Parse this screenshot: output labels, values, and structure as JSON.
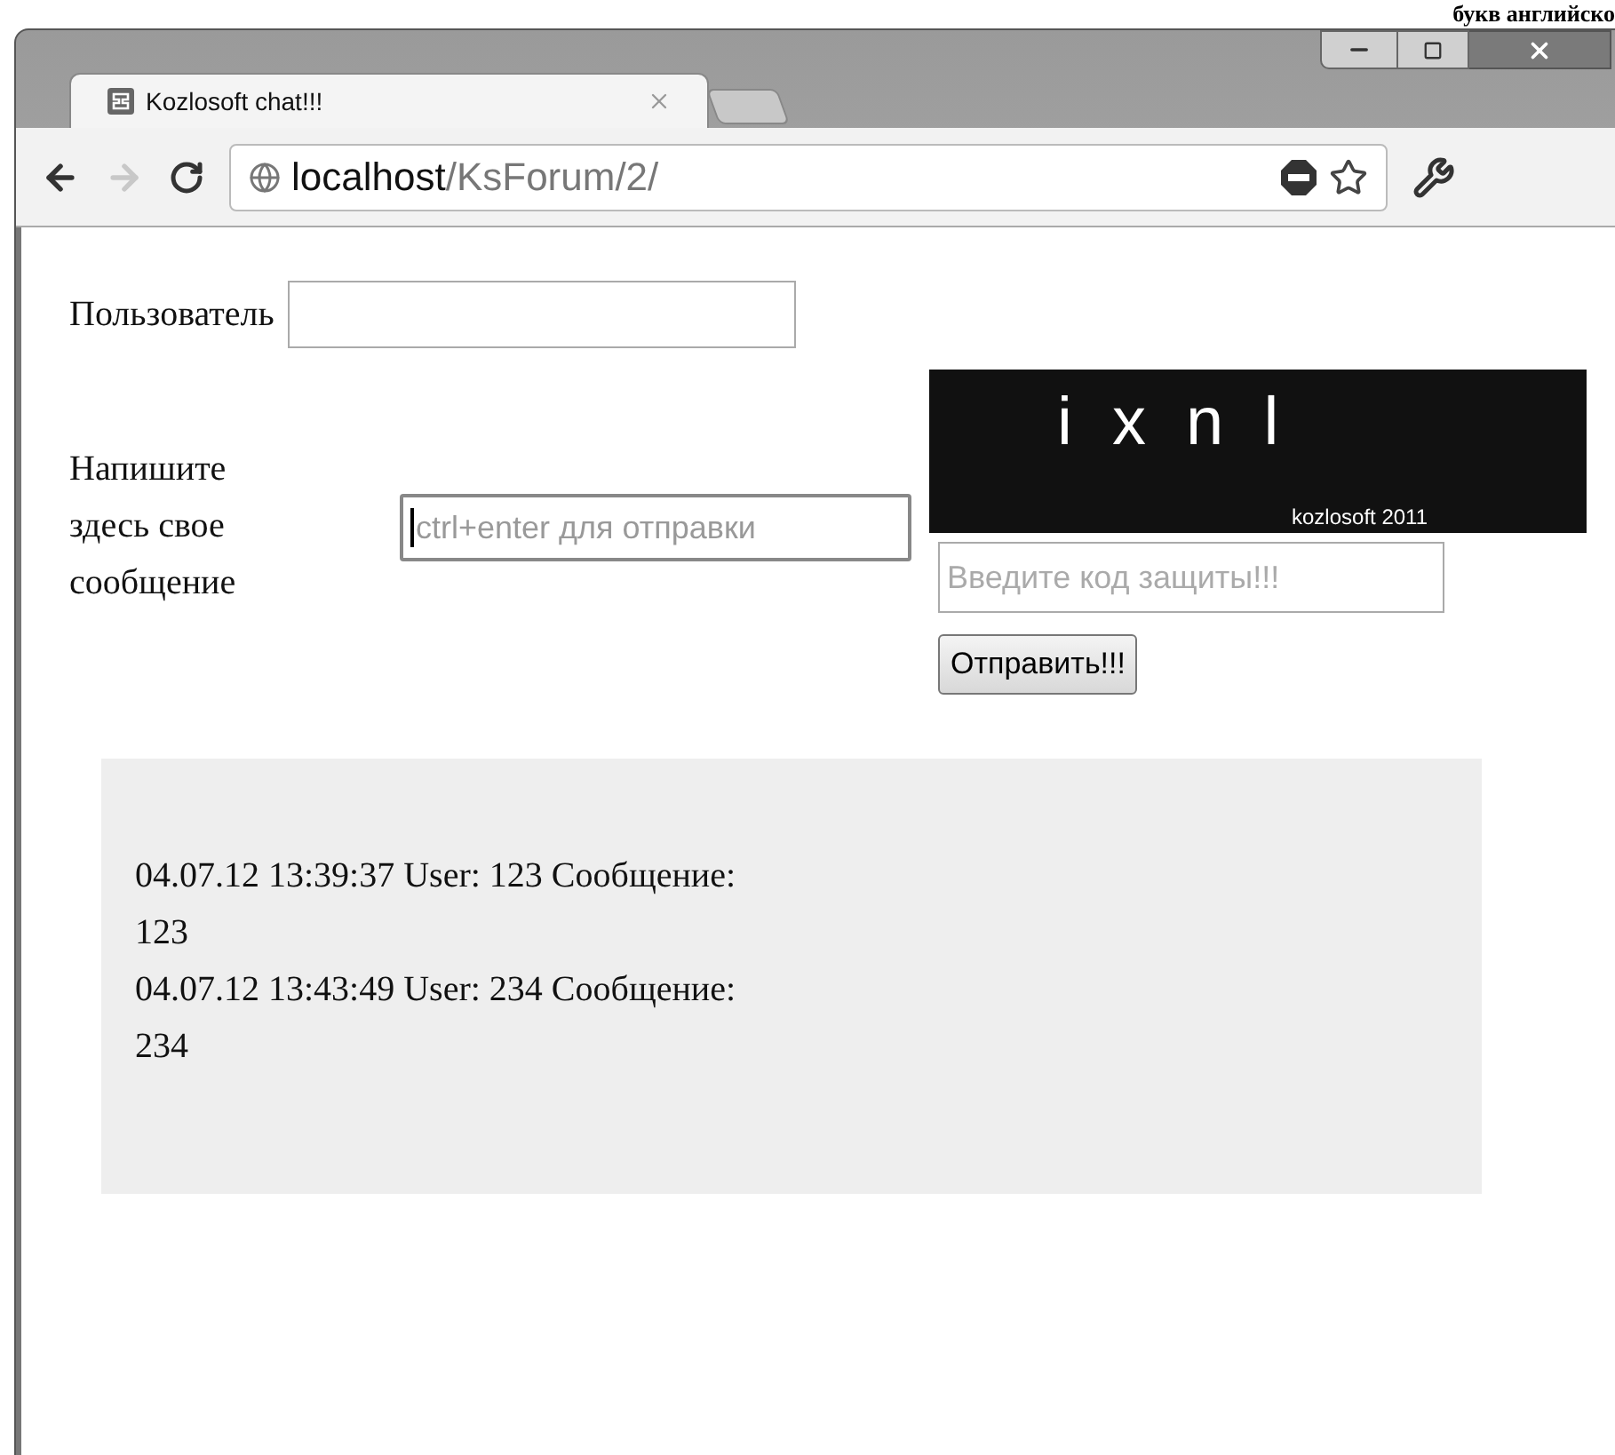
{
  "page_caption": "букв английско",
  "tabs": [
    {
      "title": "Kozlosoft chat!!!",
      "selected": true
    }
  ],
  "toolbar": {
    "back_enabled": true,
    "forward_enabled": false
  },
  "address": {
    "host": "localhost",
    "path": "/KsForum/2/"
  },
  "form": {
    "user_label": "Пользователь",
    "message_label": "Напишите здесь свое сообщение",
    "message_placeholder": "ctrl+enter для отправки",
    "message_focused": true,
    "captcha_code": "i x n l",
    "captcha_credit": "kozlosoft 2011",
    "code_placeholder": "Введите код защиты!!!",
    "submit": "Отправить!!!"
  },
  "messages": [
    {
      "header": "04.07.12 13:39:37 User: 123 Сообщение:",
      "body": "123"
    },
    {
      "header": "04.07.12 13:43:49 User: 234 Сообщение:",
      "body": "234"
    }
  ]
}
